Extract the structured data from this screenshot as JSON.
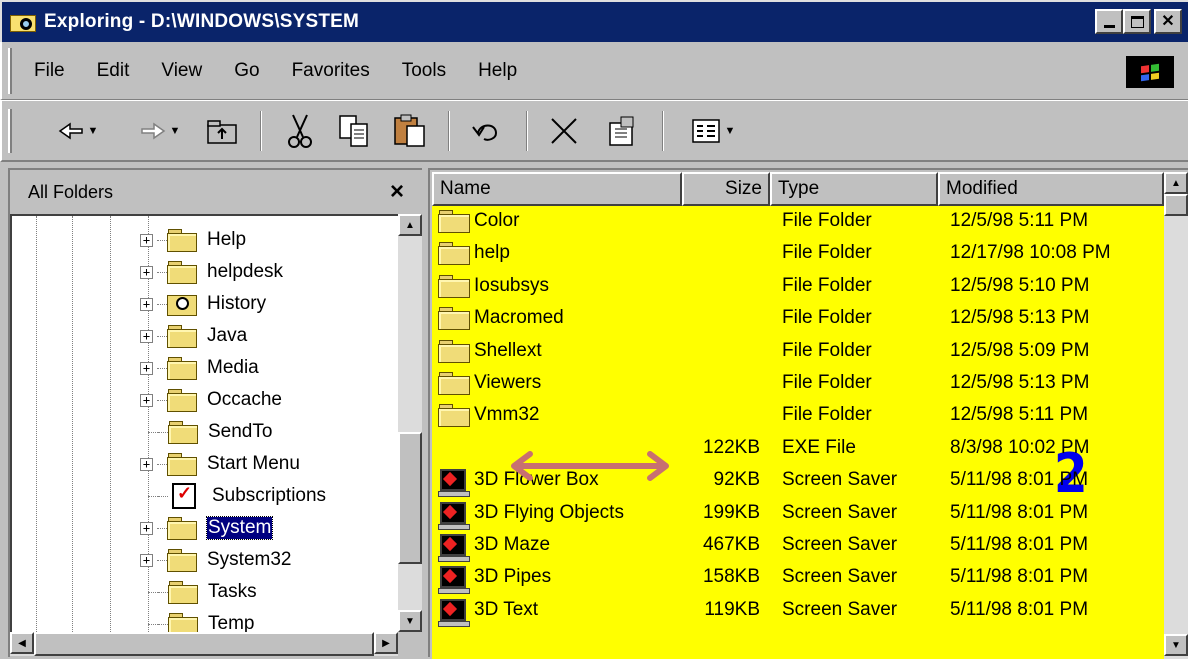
{
  "window": {
    "title": "Exploring - D:\\WINDOWS\\SYSTEM",
    "controls": {
      "minimize": "_",
      "maximize": "□",
      "close": "x"
    }
  },
  "menu": {
    "items": [
      "File",
      "Edit",
      "View",
      "Go",
      "Favorites",
      "Tools",
      "Help"
    ]
  },
  "toolbar": {
    "buttons": [
      "back",
      "forward",
      "up",
      "cut",
      "copy",
      "paste",
      "undo",
      "delete",
      "properties",
      "views"
    ]
  },
  "folders_pane": {
    "title": "All Folders",
    "close_glyph": "×",
    "items": [
      {
        "label": "Help",
        "expandable": true,
        "icon": "folder-icon"
      },
      {
        "label": "helpdesk",
        "expandable": true,
        "icon": "folder-icon"
      },
      {
        "label": "History",
        "expandable": true,
        "icon": "history-folder-icon"
      },
      {
        "label": "Java",
        "expandable": true,
        "icon": "folder-icon"
      },
      {
        "label": "Media",
        "expandable": true,
        "icon": "folder-icon"
      },
      {
        "label": "Occache",
        "expandable": true,
        "icon": "folder-icon"
      },
      {
        "label": "SendTo",
        "expandable": false,
        "icon": "folder-icon"
      },
      {
        "label": "Start Menu",
        "expandable": true,
        "icon": "folder-icon"
      },
      {
        "label": "Subscriptions",
        "expandable": false,
        "icon": "subscriptions-icon"
      },
      {
        "label": "System",
        "expandable": true,
        "icon": "open-folder-icon",
        "selected": true
      },
      {
        "label": "System32",
        "expandable": true,
        "icon": "folder-icon"
      },
      {
        "label": "Tasks",
        "expandable": false,
        "icon": "folder-icon"
      },
      {
        "label": "Temp",
        "expandable": false,
        "icon": "folder-icon"
      }
    ]
  },
  "file_list": {
    "columns": [
      "Name",
      "Size",
      "Type",
      "Modified"
    ],
    "rows": [
      {
        "name": "Color",
        "size": "",
        "type": "File Folder",
        "modified": "12/5/98 5:11 PM",
        "icon": "folder"
      },
      {
        "name": "help",
        "size": "",
        "type": "File Folder",
        "modified": "12/17/98 10:08 PM",
        "icon": "folder"
      },
      {
        "name": "Iosubsys",
        "size": "",
        "type": "File Folder",
        "modified": "12/5/98 5:10 PM",
        "icon": "folder"
      },
      {
        "name": "Macromed",
        "size": "",
        "type": "File Folder",
        "modified": "12/5/98 5:13 PM",
        "icon": "folder"
      },
      {
        "name": "Shellext",
        "size": "",
        "type": "File Folder",
        "modified": "12/5/98 5:09 PM",
        "icon": "folder"
      },
      {
        "name": "Viewers",
        "size": "",
        "type": "File Folder",
        "modified": "12/5/98 5:13 PM",
        "icon": "folder"
      },
      {
        "name": "Vmm32",
        "size": "",
        "type": "File Folder",
        "modified": "12/5/98 5:11 PM",
        "icon": "folder"
      },
      {
        "name": "",
        "size": "122KB",
        "type": "EXE File",
        "modified": "8/3/98 10:02 PM",
        "icon": "none"
      },
      {
        "name": "3D Flower Box",
        "size": "92KB",
        "type": "Screen Saver",
        "modified": "5/11/98 8:01 PM",
        "icon": "screensaver"
      },
      {
        "name": "3D Flying Objects",
        "size": "199KB",
        "type": "Screen Saver",
        "modified": "5/11/98 8:01 PM",
        "icon": "screensaver"
      },
      {
        "name": "3D Maze",
        "size": "467KB",
        "type": "Screen Saver",
        "modified": "5/11/98 8:01 PM",
        "icon": "screensaver"
      },
      {
        "name": "3D Pipes",
        "size": "158KB",
        "type": "Screen Saver",
        "modified": "5/11/98 8:01 PM",
        "icon": "screensaver"
      },
      {
        "name": "3D Text",
        "size": "119KB",
        "type": "Screen Saver",
        "modified": "5/11/98 8:01 PM",
        "icon": "screensaver"
      }
    ]
  },
  "annotations": {
    "number_label": "2",
    "arrow_color": "#c87070",
    "number_color": "#0000ee",
    "list_highlight": "#ffff00"
  }
}
